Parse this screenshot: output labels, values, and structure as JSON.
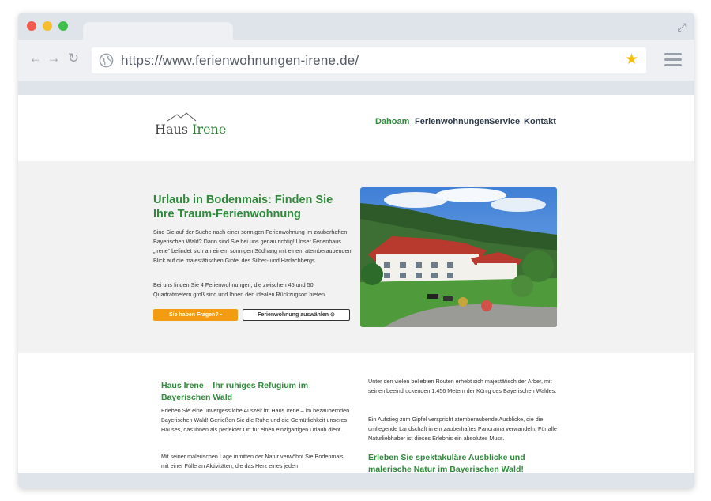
{
  "browser": {
    "url": "https://www.ferienwohnungen-irene.de/",
    "icons": {
      "back": "arrow-left-icon",
      "forward": "arrow-right-icon",
      "reload": "reload-icon",
      "site": "globe-icon",
      "bookmark": "star-icon",
      "menu": "hamburger-icon",
      "expand": "expand-icon"
    }
  },
  "header": {
    "logo": {
      "part1": "Haus ",
      "part2": "Irene"
    },
    "nav": [
      {
        "label": "Dahoam",
        "active": true
      },
      {
        "label": "Ferienwohnungen",
        "active": false
      },
      {
        "label": "Service",
        "active": false
      },
      {
        "label": "Kontakt",
        "active": false
      }
    ]
  },
  "hero": {
    "title": "Urlaub in Bodenmais: Finden Sie Ihre Traum-Ferienwohnung",
    "paragraph1": "Sind Sie auf der Suche nach einer sonnigen Ferienwohnung im zauberhaften Bayerischen Wald? Dann sind Sie bei uns genau richtig! Unser Ferienhaus „Irene“ befindet sich an einem sonnigen Südhang mit einem atemberaubenden Blick auf die majestätischen Gipfel des Silber- und Harlachbergs.",
    "paragraph2": "Bei uns finden Sie 4 Ferienwohnungen, die zwischen 45 und 50 Quadratmetern groß sind und Ihnen den idealen Rückzugsort bieten.",
    "button_primary": "Sie haben Fragen?",
    "button_secondary": "Ferienwohnung auswählen"
  },
  "content": {
    "left_heading": "Haus Irene – Ihr ruhiges Refugium im Bayerischen Wald",
    "left_p1": "Erleben Sie eine unvergessliche Auszeit im Haus Irene – im bezaubernden Bayerischen Wald! Genießen Sie die Ruhe und die Gemütlichkeit unseres Hauses, das Ihnen als perfekter Ort für einen einzigartigen Urlaub dient.",
    "left_p2": "Mit seiner malerischen Lage inmitten der Natur verwöhnt Sie Bodenmais mit einer Fülle an Aktivitäten, die das Herz eines jeden",
    "right_p1": "Unter den vielen beliebten Routen erhebt sich majestätisch der Arber, mit seinen beeindruckenden 1.456 Metern der König des Bayerischen Waldes.",
    "right_p2": "Ein Aufstieg zum Gipfel verspricht atemberaubende Ausblicke, die die umliegende Landschaft in ein zauberhaftes Panorama verwandeln. Für alle Naturliebhaber ist dieses Erlebnis ein absolutes Muss.",
    "right_heading": "Erleben Sie spektakuläre Ausblicke und malerische Natur im Bayerischen Wald!"
  },
  "colors": {
    "accent_green": "#2f8a3a",
    "button_orange": "#f39c12"
  }
}
